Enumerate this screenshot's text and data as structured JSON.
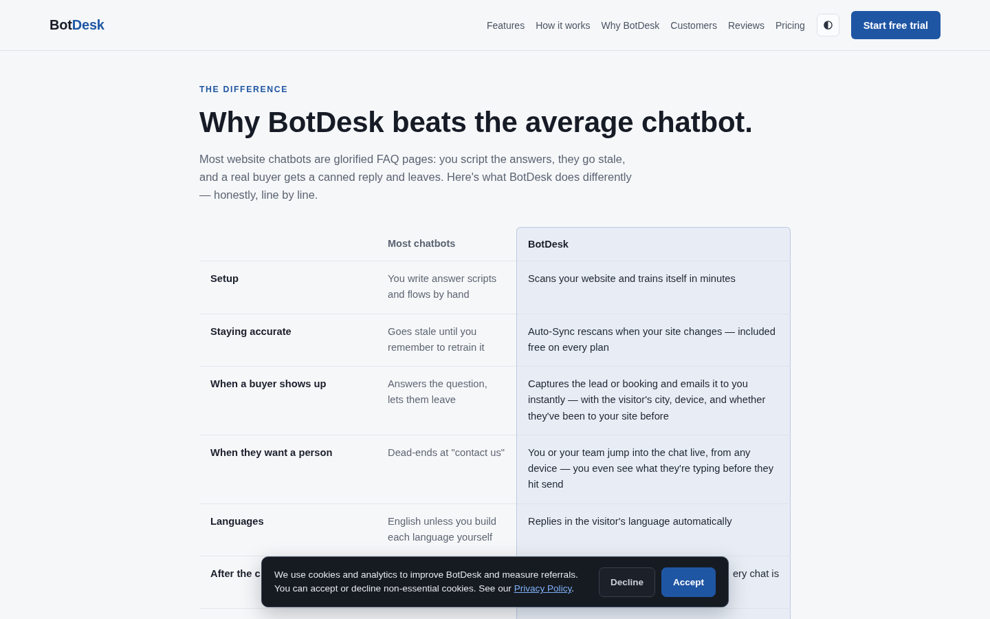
{
  "nav": {
    "logo": {
      "primary": "Bot",
      "accent": "Desk"
    },
    "links": [
      {
        "label": "Features"
      },
      {
        "label": "How it works"
      },
      {
        "label": "Why BotDesk"
      },
      {
        "label": "Customers"
      },
      {
        "label": "Reviews"
      },
      {
        "label": "Pricing"
      }
    ],
    "cta": "Start free trial"
  },
  "section": {
    "eyebrow": "THE DIFFERENCE",
    "title": "Why BotDesk beats the average chatbot.",
    "intro": "Most website chatbots are glorified FAQ pages: you script the answers, they go stale, and a real buyer gets a canned reply and leaves. Here's what BotDesk does differently — honestly, line by line."
  },
  "comparison": {
    "columns": [
      "Most chatbots",
      "BotDesk"
    ],
    "rows": [
      {
        "kind": "full",
        "feature": "Setup",
        "most_chatbots": "You write answer scripts and flows by hand",
        "botdesk": "Scans your website and trains itself in minutes"
      },
      {
        "kind": "full",
        "feature": "Staying accurate",
        "most_chatbots": "Goes stale until you remember to retrain it",
        "botdesk": "Auto-Sync rescans when your site changes — included free on every plan"
      },
      {
        "kind": "full",
        "feature": "When a buyer shows up",
        "most_chatbots": "Answers the question, lets them leave",
        "botdesk": "Captures the lead or booking and emails it to you instantly — with the visitor's city, device, and whether they've been to your site before"
      },
      {
        "kind": "full",
        "feature": "When they want a person",
        "most_chatbots": "Dead-ends at \"contact us\"",
        "botdesk": "You or your team jump into the chat live, from any device — you even see what they're typing before they hit send"
      },
      {
        "kind": "full",
        "feature": "Languages",
        "most_chatbots": "English unless you build each language yourself",
        "botdesk": "Replies in the visitor's language automatically"
      },
      {
        "kind": "obscured",
        "feature": "After the c",
        "botdesk": "ery chat is"
      }
    ]
  },
  "cookie_banner": {
    "message": "We use cookies and analytics to improve BotDesk and measure referrals. You can accept or decline non-essential cookies. See our",
    "link": "Privacy Policy",
    "message_end": ".",
    "buttons": [
      {
        "kind": "secondary",
        "label": "Decline"
      },
      {
        "kind": "primary",
        "label": "Accept"
      }
    ]
  }
}
